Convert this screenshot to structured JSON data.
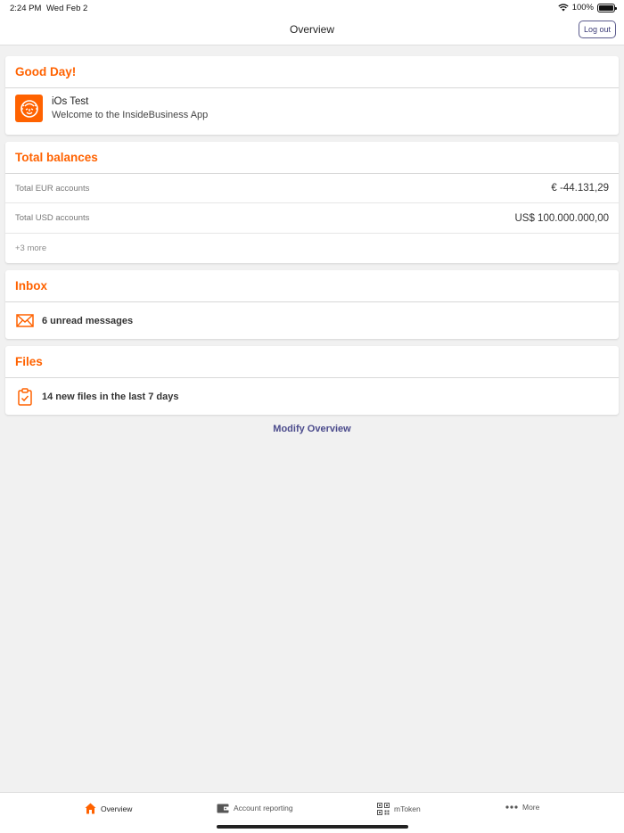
{
  "status": {
    "time": "2:24 PM",
    "date": "Wed Feb 2",
    "battery": "100%"
  },
  "nav": {
    "title": "Overview",
    "logout_label": "Log out"
  },
  "greeting": {
    "title": "Good Day!",
    "user_name": "iOs Test",
    "welcome": "Welcome to the InsideBusiness App"
  },
  "balances": {
    "title": "Total balances",
    "rows": [
      {
        "label": "Total EUR accounts",
        "value": "€ -44.131,29"
      },
      {
        "label": "Total USD accounts",
        "value": "US$ 100.000.000,00"
      }
    ],
    "more": "+3 more"
  },
  "inbox": {
    "title": "Inbox",
    "text": "6 unread messages"
  },
  "files": {
    "title": "Files",
    "text": "14 new files in the last 7 days"
  },
  "modify_label": "Modify Overview",
  "tabs": [
    {
      "label": "Overview",
      "icon": "home-icon",
      "active": true
    },
    {
      "label": "Account reporting",
      "icon": "wallet-icon",
      "active": false
    },
    {
      "label": "mToken",
      "icon": "qr-code-icon",
      "active": false
    },
    {
      "label": "More",
      "icon": "more-dots-icon",
      "active": false
    }
  ],
  "colors": {
    "accent": "#ff6200",
    "link": "#4b4b8c",
    "background": "#f1f1f1"
  }
}
